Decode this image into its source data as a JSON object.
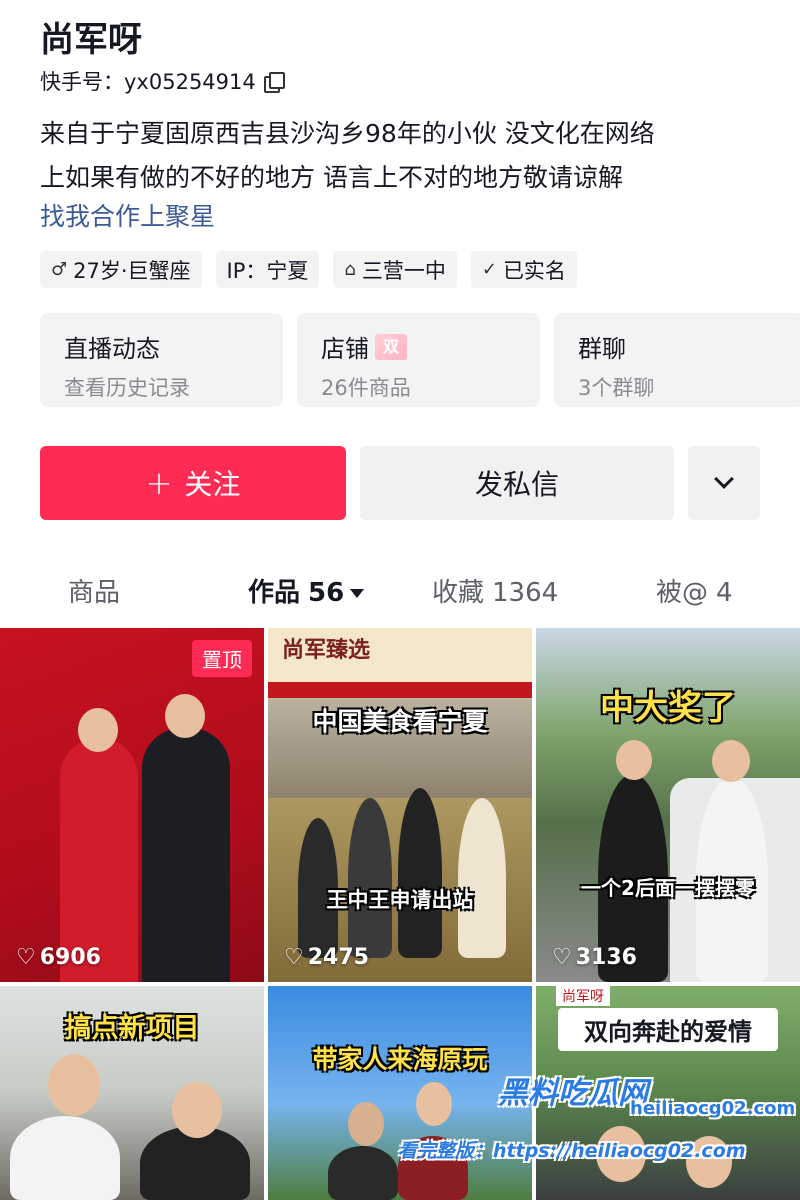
{
  "profile": {
    "name": "尚军呀",
    "uid_label": "快手号：yx05254914",
    "bio_line1": "来自于宁夏固原西吉县沙沟乡98年的小伙 没文化在网络",
    "bio_line2": "上如果有做的不好的地方 语言上不对的地方敬请谅解",
    "partner_link": "找我合作上聚星",
    "tags": [
      {
        "icon": "male-icon",
        "glyph": "♂",
        "text": "27岁·巨蟹座"
      },
      {
        "icon": "",
        "glyph": "",
        "text": "IP：宁夏"
      },
      {
        "icon": "school-icon",
        "glyph": "⌂",
        "text": "三营一中"
      },
      {
        "icon": "verified-icon",
        "glyph": "✓",
        "text": "已实名"
      }
    ]
  },
  "cards": [
    {
      "title": "直播动态",
      "sub": "查看历史记录"
    },
    {
      "title": "店铺",
      "sub": "26件商品",
      "badge": "双"
    },
    {
      "title": "群聊",
      "sub": "3个群聊"
    }
  ],
  "actions": {
    "follow_plus": "+",
    "follow_label": "关注",
    "message_label": "发私信"
  },
  "tabs": {
    "goods": "商品",
    "works": "作品",
    "works_count": "56",
    "favorites": "收藏",
    "favorites_count": "1364",
    "mentioned": "被@",
    "mentioned_count": "4"
  },
  "videos": [
    {
      "likes": "6906",
      "pinned": "置顶",
      "caption": ""
    },
    {
      "likes": "2475",
      "sign": "尚军臻选",
      "caption_top": "中国美食看宁夏",
      "caption_bottom": "王中王申请出站"
    },
    {
      "likes": "3136",
      "caption_top": "中大奖了",
      "caption_bottom": "一个2后面一摆摆零"
    },
    {
      "caption_top": "搞点新项目"
    },
    {
      "caption_top": "带家人来海原玩"
    },
    {
      "caption_top": "双向奔赴的爱情",
      "corner": "尚军呀"
    }
  ],
  "watermark": {
    "line1": "黑料吃瓜网",
    "url": "heiliaocg02.com",
    "line2": "看完整版：https://heiliaocg02.com"
  },
  "colors": {
    "accent": "#fe2c55",
    "link": "#3d5a99",
    "card_bg": "#f3f3f4"
  }
}
